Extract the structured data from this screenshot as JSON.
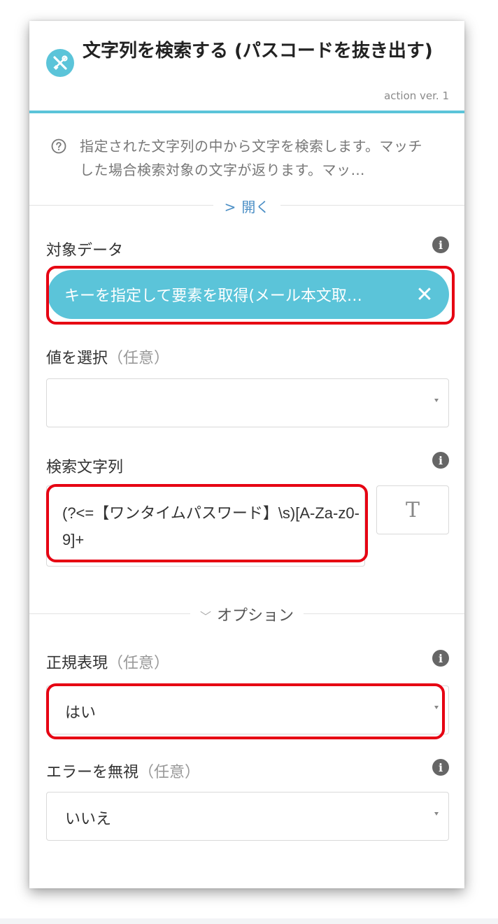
{
  "header": {
    "title": "文字列を検索する (パスコードを抜き出す)",
    "version": "action ver. 1",
    "icon": "tools-icon",
    "accent_color": "#5bc4d9"
  },
  "description": {
    "text": "指定された文字列の中から文字を検索します。マッチした場合検索対象の文字が返ります。マッ…",
    "icon": "question-circle-icon"
  },
  "open_toggle": {
    "label": "開く",
    "chevron": ">"
  },
  "fields": {
    "target_data": {
      "label": "対象データ",
      "chip_value": "キーを指定して要素を取得(メール本文取…",
      "chip_remove": "✕"
    },
    "select_value": {
      "label": "値を選択",
      "optional": "（任意）",
      "value": ""
    },
    "search_string": {
      "label": "検索文字列",
      "value": "(?<=【ワンタイムパスワード】\\s)[A-Za-z0-9]+",
      "text_button": "T"
    }
  },
  "options_toggle": {
    "label": "オプション"
  },
  "options": {
    "regex": {
      "label": "正規表現",
      "optional": "（任意）",
      "value": "はい"
    },
    "ignore_error": {
      "label": "エラーを無視",
      "optional": "（任意）",
      "value": "いいえ"
    }
  },
  "highlight_color": "#e60012"
}
